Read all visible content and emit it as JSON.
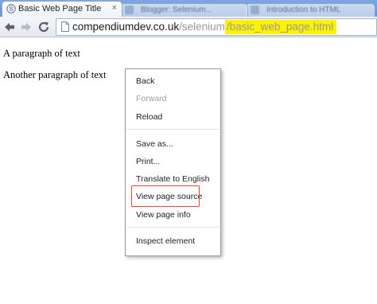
{
  "browser": {
    "active_tab": {
      "title": "Basic Web Page Title",
      "favicon": "chrome-page-icon"
    },
    "background_tabs": [
      {
        "title": "Blogger: Selenium..."
      },
      {
        "title": "Introduction to HTML"
      }
    ],
    "toolbar": {
      "back_icon": "arrow-left-icon",
      "forward_icon": "arrow-right-icon",
      "reload_icon": "reload-icon"
    },
    "address_bar": {
      "domain": "compendiumdev.co.uk",
      "path": "/selenium",
      "highlighted": "/basic_web_page.html",
      "highlight_color": "#fff200"
    }
  },
  "page": {
    "paragraph_1": "A paragraph of text",
    "paragraph_2": "Another paragraph of text"
  },
  "context_menu": {
    "items": [
      {
        "label": "Back",
        "enabled": true
      },
      {
        "label": "Forward",
        "enabled": false
      },
      {
        "label": "Reload",
        "enabled": true
      },
      {
        "label": "Save as...",
        "enabled": true
      },
      {
        "label": "Print...",
        "enabled": true
      },
      {
        "label": "Translate to English",
        "enabled": true
      },
      {
        "label": "View page source",
        "enabled": true,
        "highlighted": true
      },
      {
        "label": "View page info",
        "enabled": true
      },
      {
        "label": "Inspect element",
        "enabled": true
      }
    ],
    "highlight_box_color": "#e04b3c"
  }
}
